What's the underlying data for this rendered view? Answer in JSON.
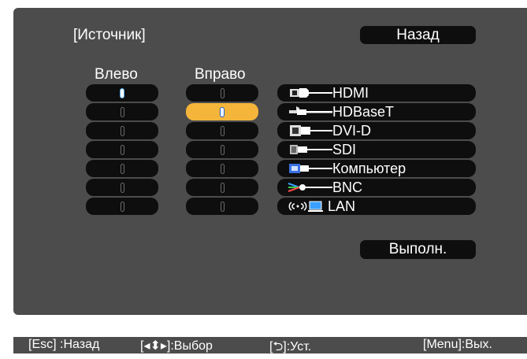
{
  "dialog": {
    "title": "[Источник]",
    "back_label": "Назад",
    "left_label": "Влево",
    "right_label": "Вправо",
    "execute_label": "Выполн.",
    "left_selected_index": 0,
    "right_selected_index": 1,
    "sources": [
      {
        "label": "HDMI",
        "icon": "hdmi-port-icon"
      },
      {
        "label": "HDBaseT",
        "icon": "hdbaset-port-icon"
      },
      {
        "label": "DVI-D",
        "icon": "dvi-port-icon"
      },
      {
        "label": "SDI",
        "icon": "sdi-port-icon"
      },
      {
        "label": "Компьютер",
        "icon": "computer-port-icon"
      },
      {
        "label": "BNC",
        "icon": "bnc-port-icon"
      },
      {
        "label": "LAN",
        "icon": "lan-wireless-icon"
      }
    ]
  },
  "footer": {
    "esc": "[Esc] :Назад",
    "select": "[◂⬍▸]:Выбор",
    "set": "[⮌]:Уст.",
    "menu": "[Menu]:Вых."
  },
  "colors": {
    "panel_bg": "#4c4c4c",
    "slot_bg": "#0e0e0e",
    "selected_slot": "#f5b53a",
    "radio_on": "#4aa8ff"
  }
}
